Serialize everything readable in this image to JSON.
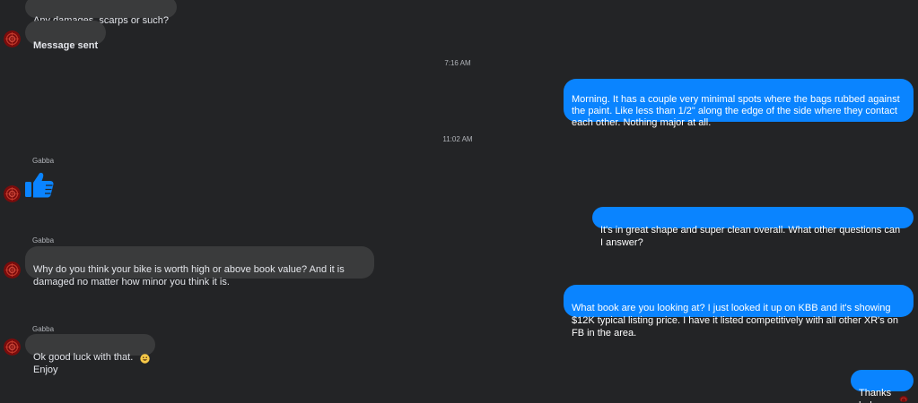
{
  "messages": [
    {
      "sender": "them",
      "text": "Any damages, scarps or such?"
    },
    {
      "sender": "them",
      "text": "Message sent"
    },
    {
      "type": "timestamp",
      "text": "7:16 AM"
    },
    {
      "sender": "me",
      "text": "Morning. It has a couple very minimal spots where the bags rubbed against the paint. Like less than 1/2\" along the edge of the side where they contact each other. Nothing major at all."
    },
    {
      "type": "timestamp",
      "text": "11:02 AM"
    },
    {
      "sender_name": "Gabba",
      "sender": "them",
      "type": "sticker",
      "sticker": "thumbs-up-icon"
    },
    {
      "sender": "me",
      "text": "It's in great shape and super clean overall. What other questions can I answer?"
    },
    {
      "sender_name": "Gabba",
      "sender": "them",
      "text": "Why do you think your bike is worth high or above book value? And it is damaged no matter how minor you think it is."
    },
    {
      "sender": "me",
      "text": "What book are you looking at? I just looked it up on KBB and it's showing $12K typical listing price. I have it listed competitively with all other XR's on FB in the area."
    },
    {
      "sender_name": "Gabba",
      "sender": "them",
      "text": "Ok good luck with that. Enjoy",
      "reaction": "grinning-face-icon"
    },
    {
      "sender": "me",
      "text": "Thanks haha",
      "seen_indicator": "avatar"
    }
  ],
  "colors": {
    "background": "#232426",
    "incoming_bubble": "#3a3b3c",
    "outgoing_bubble": "#0a84ff",
    "avatar": "#8b0f0f"
  }
}
